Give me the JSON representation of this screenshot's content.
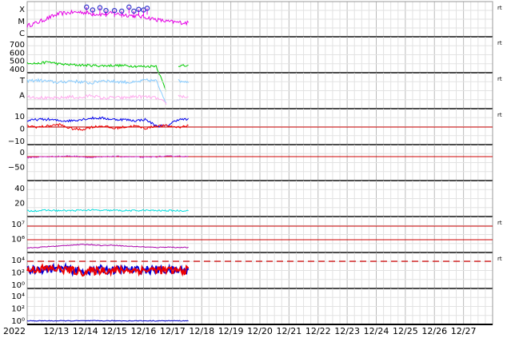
{
  "chart_data": {
    "type": "line",
    "x_start": "12/12",
    "x_end": "12/28",
    "year_label": "2022",
    "x_ticks": [
      "12/13",
      "12/14",
      "12/15",
      "12/16",
      "12/17",
      "12/18",
      "12/19",
      "12/20",
      "12/21",
      "12/22",
      "12/23",
      "12/24",
      "12/25",
      "12/26",
      "12/27"
    ],
    "data_end": "12/17 13:00",
    "colors": {
      "xray": "#e600e6",
      "flare_marker": "#3333cc",
      "density": "#00cc00",
      "temp_hi": "#88ccff",
      "temp_lo": "#bb99ee",
      "alpha": "#ffaaee",
      "field_bt": "#0000ee",
      "field_bz": "#ee0000",
      "phi": "#cc33cc",
      "speed": "#00dddd",
      "proton": "#aa00aa",
      "electron_a": "#0000dd",
      "electron_b": "#ee0000",
      "threshold": "#cc0000",
      "neutron": "#0000cc"
    },
    "panels": [
      {
        "name": "xray",
        "tick_labels": [
          "X",
          "M",
          "C"
        ],
        "right_label": "rt",
        "series": [
          {
            "key": "xray",
            "values": [
              0.2,
              0.32,
              0.48,
              0.62,
              0.66,
              0.68,
              0.62,
              0.6,
              0.64,
              0.58,
              0.55,
              0.5,
              0.42,
              0.35,
              0.32,
              0.3
            ]
          }
        ],
        "flare_peaks": [
          {
            "x": "12/14 01:00",
            "y": 0.92
          },
          {
            "x": "12/14 06:00",
            "y": 0.82
          },
          {
            "x": "12/14 12:00",
            "y": 0.9
          },
          {
            "x": "12/14 17:00",
            "y": 0.8
          },
          {
            "x": "12/15 00:00",
            "y": 0.8
          },
          {
            "x": "12/15 06:00",
            "y": 0.78
          },
          {
            "x": "12/15 12:00",
            "y": 0.92
          },
          {
            "x": "12/15 16:00",
            "y": 0.78
          },
          {
            "x": "12/15 20:00",
            "y": 0.84
          },
          {
            "x": "12/16 00:00",
            "y": 0.82
          },
          {
            "x": "12/16 03:00",
            "y": 0.88
          }
        ]
      },
      {
        "name": "density",
        "tick_labels": [
          "700",
          "600",
          "500",
          "400"
        ],
        "right_label": "rt",
        "series": [
          {
            "key": "density",
            "values": [
              420,
              405,
              430,
              400,
              390,
              385,
              380,
              375,
              380,
              378,
              370,
              365,
              375,
              0,
              380,
              370
            ]
          }
        ]
      },
      {
        "name": "temperature",
        "tick_labels": [
          "T",
          "A"
        ],
        "right_label": "rt",
        "series": [
          {
            "key": "temp_hi",
            "values": [
              0.78,
              0.8,
              0.76,
              0.72,
              0.78,
              0.74,
              0.7,
              0.8,
              0.76,
              0.74,
              0.72,
              0.8,
              0.78,
              0.0,
              0.78,
              0.76
            ]
          },
          {
            "key": "alpha",
            "values": [
              0.25,
              0.22,
              0.18,
              0.2,
              0.24,
              0.2,
              0.3,
              0.18,
              0.22,
              0.2,
              0.25,
              0.24,
              0.2,
              0.0,
              0.28,
              0.22
            ]
          }
        ]
      },
      {
        "name": "field",
        "tick_labels": [
          "10",
          "0",
          "−10"
        ],
        "right_label": "rt",
        "series": [
          {
            "key": "field_bt",
            "values": [
              4,
              5,
              5,
              4,
              4,
              5,
              6,
              6,
              5,
              5,
              4,
              5,
              0,
              0,
              5,
              5
            ]
          },
          {
            "key": "field_bz",
            "values": [
              0,
              -1,
              0,
              1,
              -2,
              -3,
              -1,
              0,
              -2,
              -1,
              0,
              -2,
              0,
              0,
              -1,
              0
            ]
          }
        ]
      },
      {
        "name": "phi",
        "tick_labels": [
          "0",
          "−50"
        ],
        "right_label": "",
        "series": [
          {
            "key": "phi",
            "values": [
              -5,
              -3,
              -2,
              -1,
              0,
              -2,
              -5,
              -3,
              -1,
              -2,
              -3,
              -4,
              -2,
              -1,
              0,
              -2
            ]
          }
        ]
      },
      {
        "name": "speed",
        "tick_labels": [
          "40",
          "20"
        ],
        "right_label": "",
        "series": [
          {
            "key": "speed",
            "values": [
              5,
              6,
              7,
              6,
              6,
              7,
              8,
              6,
              7,
              6,
              6,
              7,
              6,
              6,
              6,
              6
            ]
          }
        ]
      },
      {
        "name": "proton",
        "tick_labels": [
          "10⁷",
          "10⁶"
        ],
        "right_label": "rt",
        "series": [
          {
            "key": "proton",
            "values": [
              0.2,
              0.3,
              0.5,
              0.6,
              0.8,
              0.9,
              0.9,
              0.7,
              0.8,
              0.6,
              0.5,
              0.4,
              0.3,
              0.4,
              0.3,
              0.3
            ]
          }
        ]
      },
      {
        "name": "electron",
        "tick_labels": [
          "10⁴",
          "10²",
          "10⁰"
        ],
        "right_label": "rt",
        "series": [
          {
            "key": "electron_a",
            "values": [
              0.45,
              0.3,
              0.25,
              0.2,
              0.35,
              0.6,
              0.45,
              0.3,
              0.4,
              0.35,
              0.4,
              0.38,
              0.35,
              0.4,
              0.45,
              0.4
            ]
          },
          {
            "key": "electron_b",
            "values": [
              0.4,
              0.25,
              0.22,
              0.28,
              0.4,
              0.65,
              0.55,
              0.4,
              0.45,
              0.4,
              0.42,
              0.4,
              0.38,
              0.44,
              0.48,
              0.42
            ]
          }
        ]
      },
      {
        "name": "neutron",
        "tick_labels": [
          "10⁴",
          "10²",
          "10⁰"
        ],
        "right_label": "",
        "series": [
          {
            "key": "neutron",
            "values": [
              1,
              1,
              1,
              1,
              1,
              1,
              1,
              1,
              1,
              1,
              1,
              1,
              1,
              1,
              1,
              1
            ]
          }
        ]
      }
    ]
  }
}
